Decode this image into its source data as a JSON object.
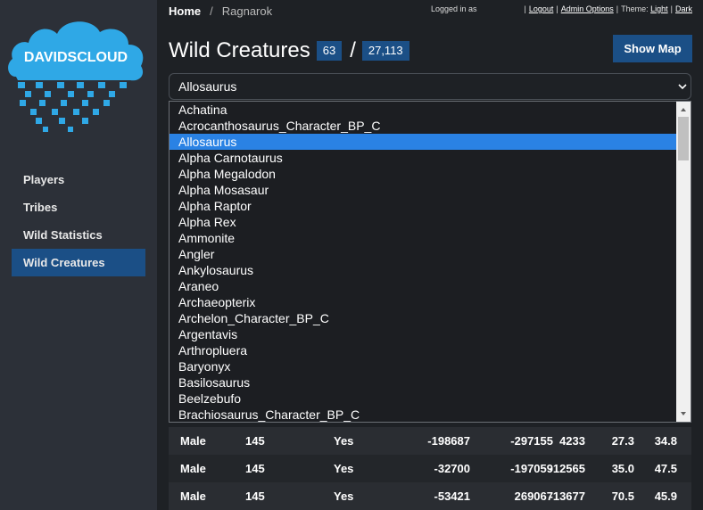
{
  "logo": {
    "text": "DAVIDSCLOUD"
  },
  "sidebar": {
    "items": [
      {
        "label": "Players",
        "active": false
      },
      {
        "label": "Tribes",
        "active": false
      },
      {
        "label": "Wild Statistics",
        "active": false
      },
      {
        "label": "Wild Creatures",
        "active": true
      }
    ]
  },
  "header": {
    "breadcrumb": {
      "home": "Home",
      "separator": "/",
      "current": "Ragnarok"
    },
    "logged_in": "Logged in as",
    "links": {
      "logout": "Logout",
      "admin": "Admin Options",
      "theme_label": "Theme:",
      "light": "Light",
      "dark": "Dark"
    }
  },
  "main": {
    "title": "Wild Creatures",
    "count": "63",
    "slash": "/",
    "total": "27,113",
    "show_map": "Show Map",
    "select_value": "Allosaurus",
    "options": [
      "Achatina",
      "Acrocanthosaurus_Character_BP_C",
      "Allosaurus",
      "Alpha Carnotaurus",
      "Alpha Megalodon",
      "Alpha Mosasaur",
      "Alpha Raptor",
      "Alpha Rex",
      "Ammonite",
      "Angler",
      "Ankylosaurus",
      "Araneo",
      "Archaeopterix",
      "Archelon_Character_BP_C",
      "Argentavis",
      "Arthropluera",
      "Baryonyx",
      "Basilosaurus",
      "Beelzebufo",
      "Brachiosaurus_Character_BP_C"
    ],
    "selected_index": 2,
    "rows": [
      [
        "Male",
        "145",
        "Yes",
        "-198687",
        "-297155",
        "4233",
        "27.3",
        "34.8"
      ],
      [
        "Male",
        "145",
        "Yes",
        "-32700",
        "-197059",
        "-12565",
        "35.0",
        "47.5"
      ],
      [
        "Male",
        "145",
        "Yes",
        "-53421",
        "269067",
        "-13677",
        "70.5",
        "45.9"
      ]
    ]
  },
  "colors": {
    "accent": "#1b4f86",
    "selected_option": "#2a82e4",
    "logo_blue": "#2fa8e6"
  }
}
